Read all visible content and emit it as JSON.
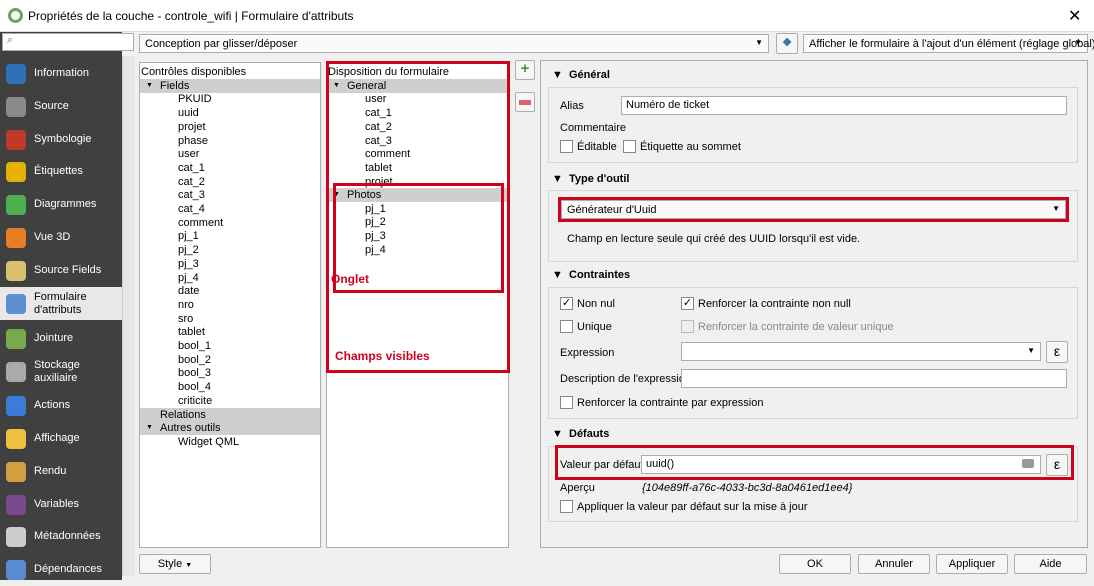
{
  "window": {
    "title": "Propriétés de la couche - controle_wifi | Formulaire d'attributs",
    "close": "✕"
  },
  "sidebar": {
    "items": [
      {
        "label": "Information",
        "color": "#2f6fb5"
      },
      {
        "label": "Source",
        "color": "#8a8a8a"
      },
      {
        "label": "Symbologie",
        "color": "#c0392b"
      },
      {
        "label": "Étiquettes",
        "color": "#e5b000"
      },
      {
        "label": "Diagrammes",
        "color": "#4caf50"
      },
      {
        "label": "Vue 3D",
        "color": "#e67e22"
      },
      {
        "label": "Source Fields",
        "color": "#d8c070"
      },
      {
        "label": "Formulaire d'attributs",
        "color": "#5b8fd0",
        "selected": true
      },
      {
        "label": "Jointure",
        "color": "#7aa84f"
      },
      {
        "label": "Stockage auxiliaire",
        "color": "#aaaaaa"
      },
      {
        "label": "Actions",
        "color": "#3d7bd8"
      },
      {
        "label": "Affichage",
        "color": "#f0c040"
      },
      {
        "label": "Rendu",
        "color": "#d0a040"
      },
      {
        "label": "Variables",
        "color": "#7a4a8a"
      },
      {
        "label": "Métadonnées",
        "color": "#cccccc"
      },
      {
        "label": "Dépendances",
        "color": "#5a8ad0"
      }
    ]
  },
  "toolbar": {
    "layout_mode": "Conception par glisser/déposer",
    "show_form": "Afficher le formulaire à l'ajout d'un élément (réglage global)"
  },
  "available": {
    "header": "Contrôles disponibles",
    "fields_group": "Fields",
    "fields": [
      "PKUID",
      "uuid",
      "projet",
      "phase",
      "user",
      "cat_1",
      "cat_2",
      "cat_3",
      "cat_4",
      "comment",
      "pj_1",
      "pj_2",
      "pj_3",
      "pj_4",
      "date",
      "nro",
      "sro",
      "tablet",
      "bool_1",
      "bool_2",
      "bool_3",
      "bool_4",
      "criticite"
    ],
    "relations": "Relations",
    "other_group": "Autres outils",
    "other": [
      "Widget QML"
    ]
  },
  "layout": {
    "header": "Disposition du formulaire",
    "tabs": [
      {
        "name": "General",
        "fields": [
          "user",
          "cat_1",
          "cat_2",
          "cat_3",
          "comment",
          "tablet",
          "projet"
        ]
      },
      {
        "name": "Photos",
        "fields": [
          "pj_1",
          "pj_2",
          "pj_3",
          "pj_4"
        ]
      }
    ]
  },
  "annotations": {
    "tab": "Onglet",
    "visible": "Champs visibles"
  },
  "general": {
    "title": "Général",
    "alias_label": "Alias",
    "alias": "Numéro de ticket",
    "comment_label": "Commentaire",
    "editable": "Éditable",
    "label_top": "Étiquette au sommet"
  },
  "widget": {
    "title": "Type d'outil",
    "type": "Générateur d'Uuid",
    "desc": "Champ en lecture seule qui créé des UUID lorsqu'il est vide."
  },
  "constraints": {
    "title": "Contraintes",
    "not_null": "Non nul",
    "not_null_checked": true,
    "enforce_not_null": "Renforcer la contrainte non null",
    "enforce_not_null_checked": true,
    "unique": "Unique",
    "enforce_unique": "Renforcer la contrainte de valeur unique",
    "expression_label": "Expression",
    "expr_desc_label": "Description de l'expression",
    "enforce_expr": "Renforcer la contrainte par expression",
    "epsilon": "ε"
  },
  "defaults": {
    "title": "Défauts",
    "value_label": "Valeur par défaut",
    "value": "uuid()",
    "preview_label": "Aperçu",
    "preview": "{104e89ff-a76c-4033-bc3d-8a0461ed1ee4}",
    "apply_on_update": "Appliquer la valeur par défaut sur la mise à jour"
  },
  "buttons": {
    "style": "Style",
    "ok": "OK",
    "cancel": "Annuler",
    "apply": "Appliquer",
    "help": "Aide"
  },
  "colors": {
    "annotation": "#d0021b",
    "sidebar": "#404040"
  }
}
